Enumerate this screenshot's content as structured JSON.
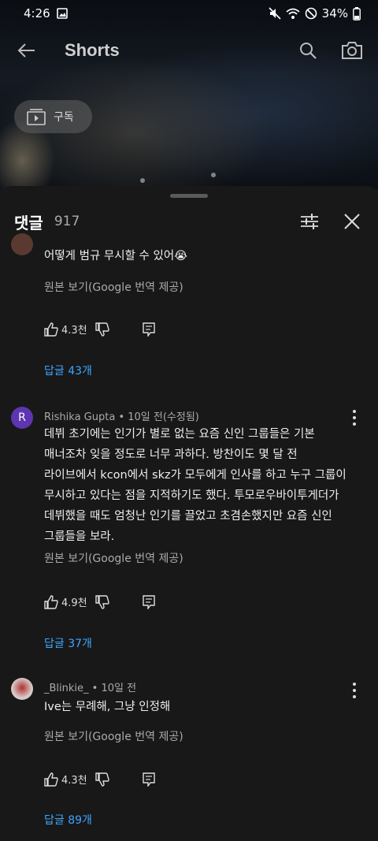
{
  "status_bar": {
    "time": "4:26",
    "battery": "34%"
  },
  "header": {
    "title": "Shorts"
  },
  "subscribe": {
    "label": "구독"
  },
  "comments_sheet": {
    "title": "댓글",
    "count": "917",
    "comments": [
      {
        "author": "",
        "time": "",
        "text": "어떻게 범규 무시할 수 있어😭",
        "translate_label": "원본 보기(Google 번역 제공)",
        "likes": "4.3천",
        "replies_label": "답글 43개",
        "avatar_color": "#5a3a30"
      },
      {
        "author": "Rishika Gupta",
        "time": "10일 전(수정됨)",
        "avatar_letter": "R",
        "avatar_color": "#5e35b1",
        "lines": [
          "데뷔 초기에는 인기가 별로 없는 요즘 신인 그룹들은 기본",
          "매너조차 잊을 정도로 너무 과하다. 방찬이도 몇 달 전",
          "라이브에서 kcon에서 skz가 모두에게 인사를 하고 누구 그룹이",
          "무시하고 있다는 점을 지적하기도 했다. 투모로우바이투게더가",
          "데뷔했을 때도 엄청난 인기를 끌었고 초겸손했지만 요즘 신인",
          "그룹들을 보라."
        ],
        "translate_label": "원본 보기(Google 번역 제공)",
        "likes": "4.9천",
        "replies_label": "답글 37개"
      },
      {
        "author": "_Blinkie_",
        "time": "10일 전",
        "avatar_color": "#d8c8c8",
        "text": "Ive는 무례해, 그냥 인정해",
        "translate_label": "원본 보기(Google 번역 제공)",
        "likes": "4.3천",
        "replies_label": "답글 89개"
      }
    ]
  },
  "colors": {
    "accent_link": "#3ea6ff",
    "sheet_bg": "#181818"
  },
  "icons": [
    "back-arrow-icon",
    "search-icon",
    "camera-icon",
    "subscriptions-icon",
    "filter-icon",
    "close-icon",
    "thumbs-up-icon",
    "thumbs-down-icon",
    "reply-icon",
    "more-vert-icon"
  ]
}
